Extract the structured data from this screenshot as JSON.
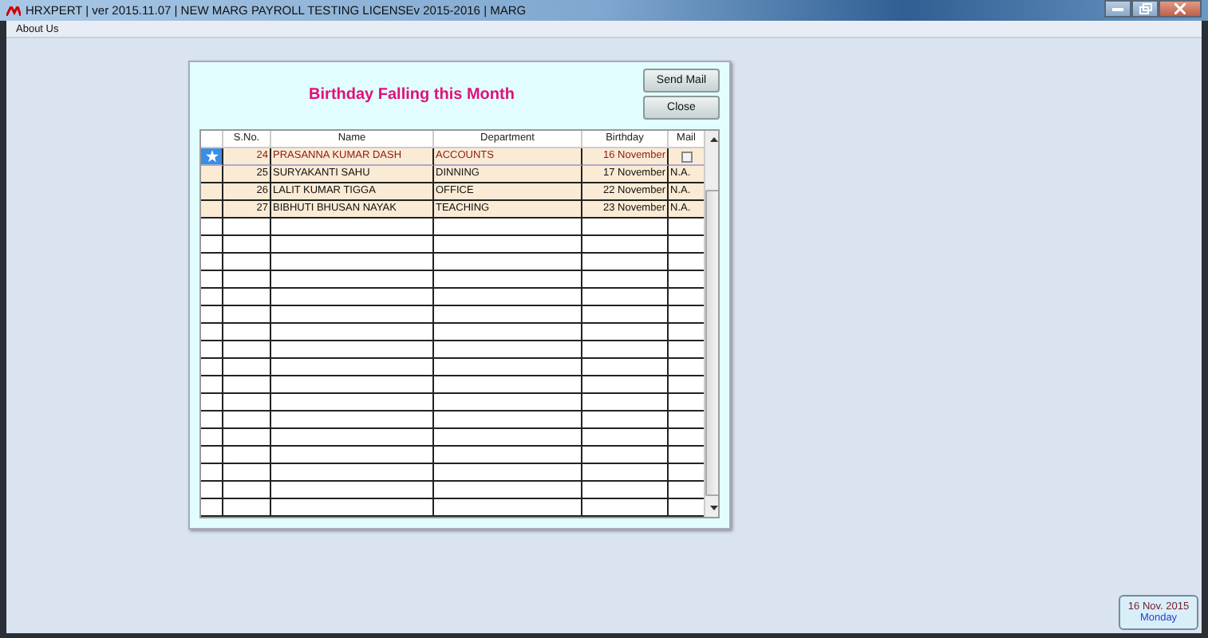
{
  "window": {
    "title": "HRXPERT | ver 2015.11.07 | NEW MARG PAYROLL TESTING LICENSEv 2015-2016 | MARG"
  },
  "menu": [
    "About Us"
  ],
  "dialog": {
    "title": "Birthday Falling this Month",
    "buttons": [
      "Send Mail",
      "Close"
    ],
    "table": {
      "columns": [
        "S.No.",
        "Name",
        "Department",
        "Birthday",
        "Mail"
      ],
      "rows": [
        {
          "selected": true,
          "sno": "24",
          "name": "PRASANNA KUMAR DASH",
          "department": "ACCOUNTS",
          "birthday": "16 November",
          "mail": {
            "kind": "checkbox",
            "checked": false
          }
        },
        {
          "selected": false,
          "sno": "25",
          "name": "SURYAKANTI SAHU",
          "department": "DINNING",
          "birthday": "17 November",
          "mail": {
            "kind": "text",
            "text": "N.A."
          }
        },
        {
          "selected": false,
          "sno": "26",
          "name": "LALIT KUMAR TIGGA",
          "department": "OFFICE",
          "birthday": "22 November",
          "mail": {
            "kind": "text",
            "text": "N.A."
          }
        },
        {
          "selected": false,
          "sno": "27",
          "name": "BIBHUTI BHUSAN NAYAK",
          "department": "TEACHING",
          "birthday": "23 November",
          "mail": {
            "kind": "text",
            "text": "N.A."
          }
        }
      ]
    }
  },
  "status": {
    "date": "16 Nov. 2015",
    "day": "Monday"
  }
}
